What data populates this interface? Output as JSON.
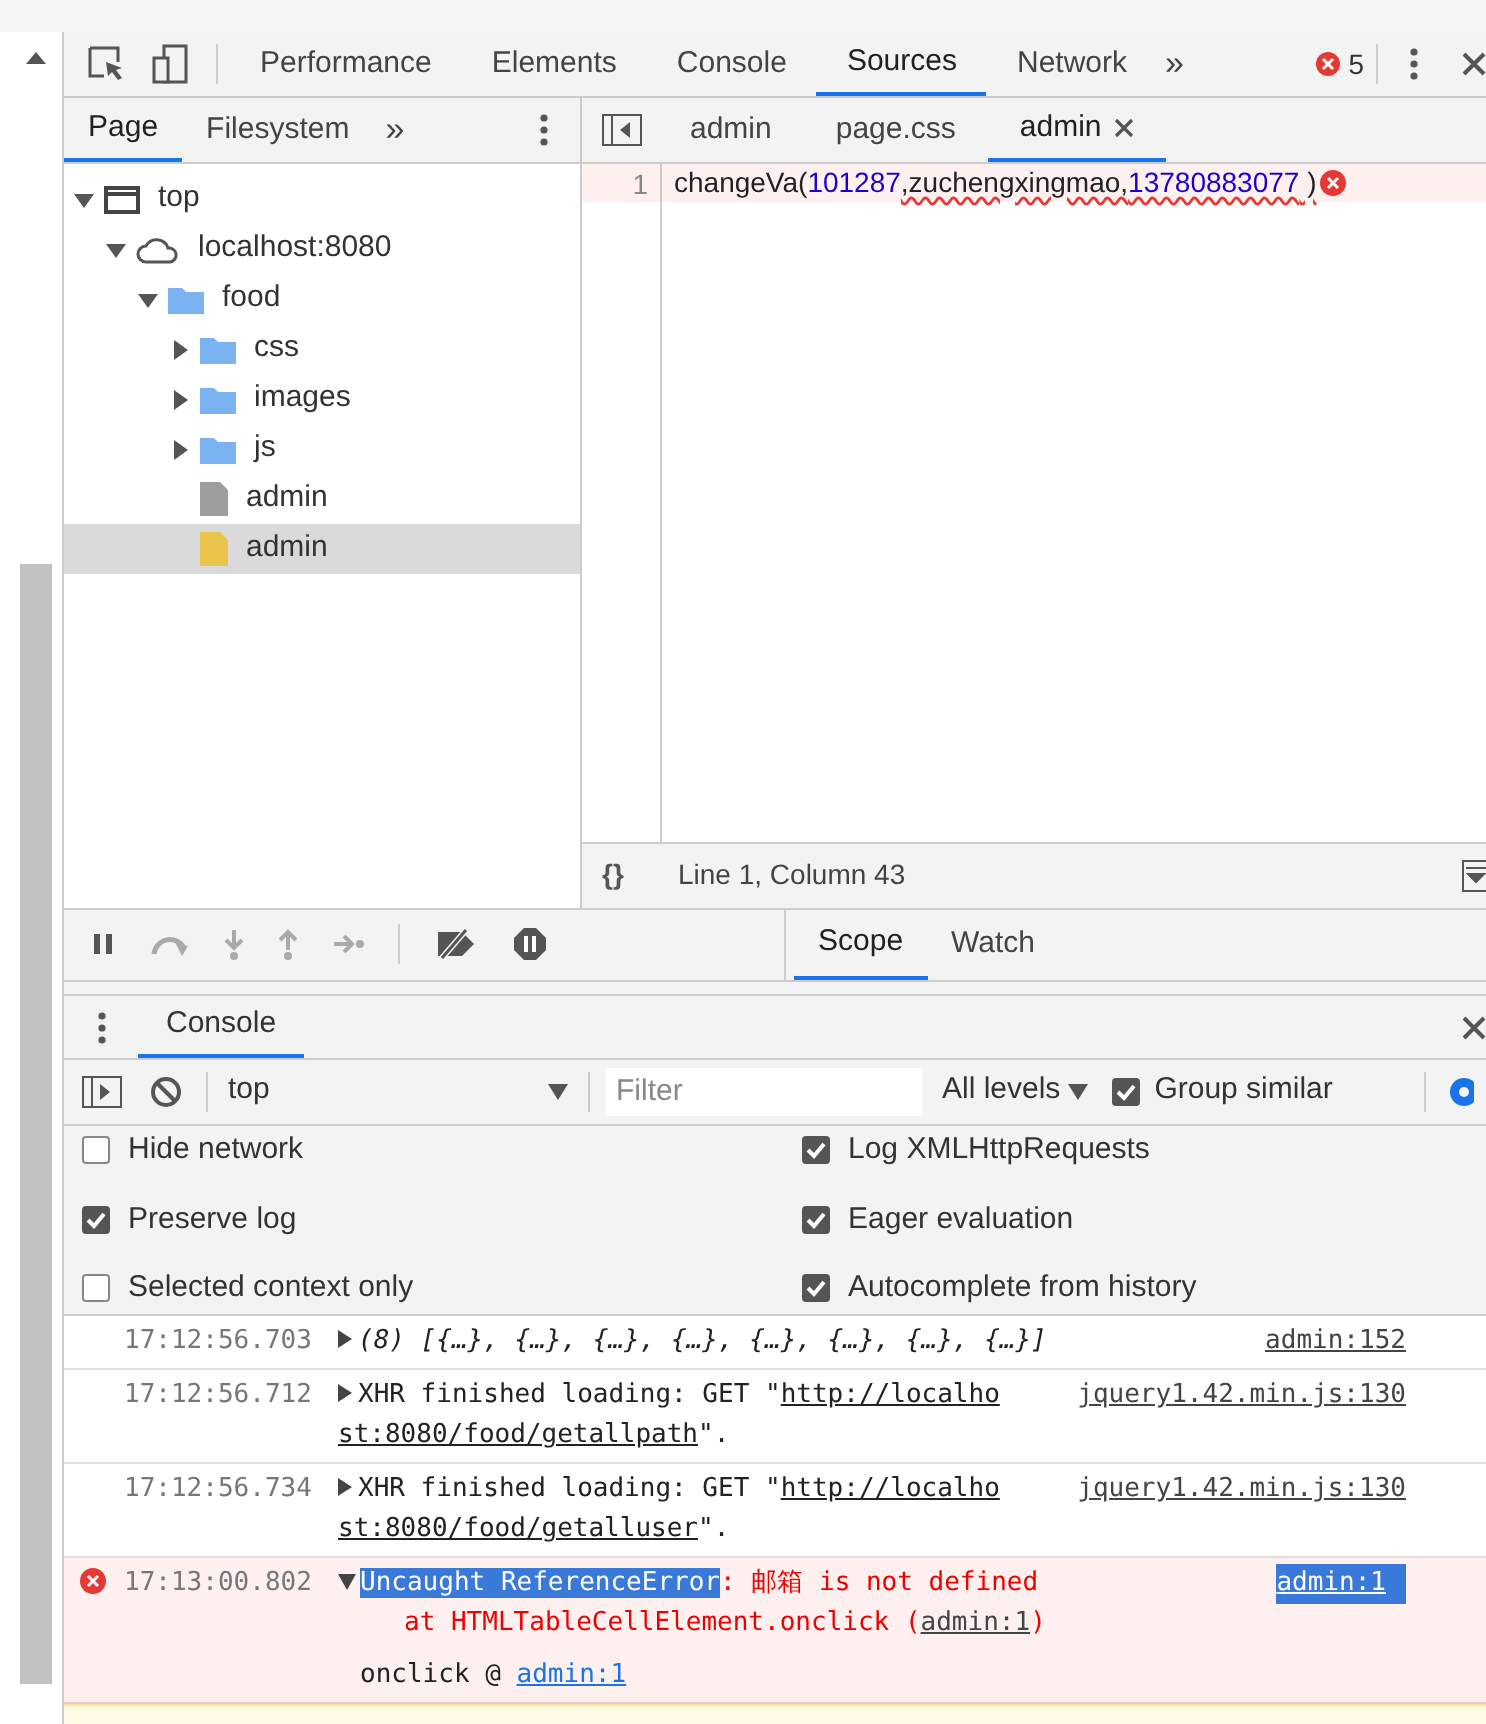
{
  "toolbar": {
    "tabs": [
      {
        "label": "Performance",
        "selected": false
      },
      {
        "label": "Elements",
        "selected": false
      },
      {
        "label": "Console",
        "selected": false
      },
      {
        "label": "Sources",
        "selected": true
      },
      {
        "label": "Network",
        "selected": false
      }
    ],
    "more": "»",
    "error_count": "5"
  },
  "navigator": {
    "tabs": [
      {
        "label": "Page",
        "selected": true
      },
      {
        "label": "Filesystem",
        "selected": false
      }
    ],
    "more": "»",
    "tree": [
      {
        "kind": "frame",
        "label": "top",
        "expanded": true,
        "selected": false,
        "children": [
          {
            "kind": "cloud",
            "label": "localhost:8080",
            "expanded": true,
            "selected": false,
            "children": [
              {
                "kind": "folder",
                "label": "food",
                "expanded": true,
                "selected": false,
                "children": [
                  {
                    "kind": "folder",
                    "label": "css",
                    "expanded": false,
                    "selected": false
                  },
                  {
                    "kind": "folder",
                    "label": "images",
                    "expanded": false,
                    "selected": false
                  },
                  {
                    "kind": "folder",
                    "label": "js",
                    "expanded": false,
                    "selected": false
                  },
                  {
                    "kind": "file",
                    "label": "admin",
                    "color": "#9e9e9e",
                    "selected": false
                  },
                  {
                    "kind": "file",
                    "label": "admin",
                    "color": "#e8c54a",
                    "selected": true
                  }
                ]
              }
            ]
          }
        ]
      }
    ]
  },
  "editor": {
    "tabs": [
      {
        "label": "admin",
        "selected": false,
        "closable": false
      },
      {
        "label": "page.css",
        "selected": false,
        "closable": false
      },
      {
        "label": "admin",
        "selected": true,
        "closable": true
      }
    ],
    "lines": [
      {
        "number": "1",
        "error": true,
        "tokens": [
          {
            "kind": "plain",
            "text": "changeVa(",
            "squiggle": false
          },
          {
            "kind": "number",
            "text": "101287",
            "squiggle": false
          },
          {
            "kind": "plain",
            "text": ",zuchengxingmao,",
            "squiggle": true
          },
          {
            "kind": "number",
            "text": "13780883077",
            "squiggle": true
          },
          {
            "kind": "plain",
            "text": " )",
            "squiggle": true
          }
        ]
      }
    ],
    "status": "Line 1, Column 43",
    "format": "{}"
  },
  "debugger": {
    "tabs": [
      {
        "label": "Scope",
        "selected": true
      },
      {
        "label": "Watch",
        "selected": false
      }
    ]
  },
  "drawer": {
    "tab": "Console",
    "context": "top",
    "filter_placeholder": "Filter",
    "levels": "All levels",
    "group_similar": {
      "label": "Group similar",
      "checked": true
    },
    "settings": [
      {
        "label": "Hide network",
        "checked": false
      },
      {
        "label": "Log XMLHttpRequests",
        "checked": true
      },
      {
        "label": "Preserve log",
        "checked": true
      },
      {
        "label": "Eager evaluation",
        "checked": true
      },
      {
        "label": "Selected context only",
        "checked": false
      },
      {
        "label": "Autocomplete from history",
        "checked": true
      }
    ],
    "messages": [
      {
        "kind": "log",
        "time": "17:12:56.703",
        "lines": [
          "(8) [{…}, {…}, {…}, {…}, {…}, {…}, {…}, {…}]"
        ],
        "source": "admin:152"
      },
      {
        "kind": "xhr",
        "time": "17:12:56.712",
        "prefix": "XHR finished loading: GET \"",
        "url1": "http://localho",
        "url2": "st:8080/food/getallpath",
        "suffix": "\".",
        "source": "jquery1.42.min.js:130"
      },
      {
        "kind": "xhr",
        "time": "17:12:56.734",
        "prefix": "XHR finished loading: GET \"",
        "url1": "http://localho",
        "url2": "st:8080/food/getalluser",
        "suffix": "\".",
        "source": "jquery1.42.min.js:130"
      },
      {
        "kind": "error",
        "time": "17:13:00.802",
        "error_name": "Uncaught ReferenceError",
        "message": ": 邮箱 is not defined",
        "at": "at HTMLTableCellElement.onclick (",
        "at_link": "admin:1",
        "at_end": ")",
        "stack_fn": "onclick @ ",
        "stack_link": "admin:1",
        "source": "admin:1"
      }
    ]
  }
}
